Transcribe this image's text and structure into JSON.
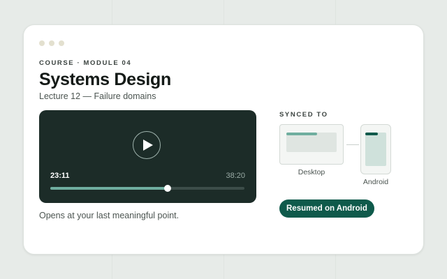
{
  "course": {
    "eyebrow": "COURSE · MODULE 04",
    "title": "Systems Design",
    "lecture": "Lecture 12 — Failure domains"
  },
  "player": {
    "current_time": "23:11",
    "total_time": "38:20",
    "progress": 0.6047,
    "play_icon": "play-icon"
  },
  "caption": "Opens at your last meaningful point.",
  "sync": {
    "label": "SYNCED TO",
    "devices": [
      {
        "name": "Desktop",
        "icon": "desktop-icon"
      },
      {
        "name": "Android",
        "icon": "phone-icon"
      }
    ],
    "status": "Resumed on Android"
  },
  "colors": {
    "accent": "#0f5a4b",
    "progress": "#6fae9f",
    "player_bg": "#1c2c28"
  }
}
